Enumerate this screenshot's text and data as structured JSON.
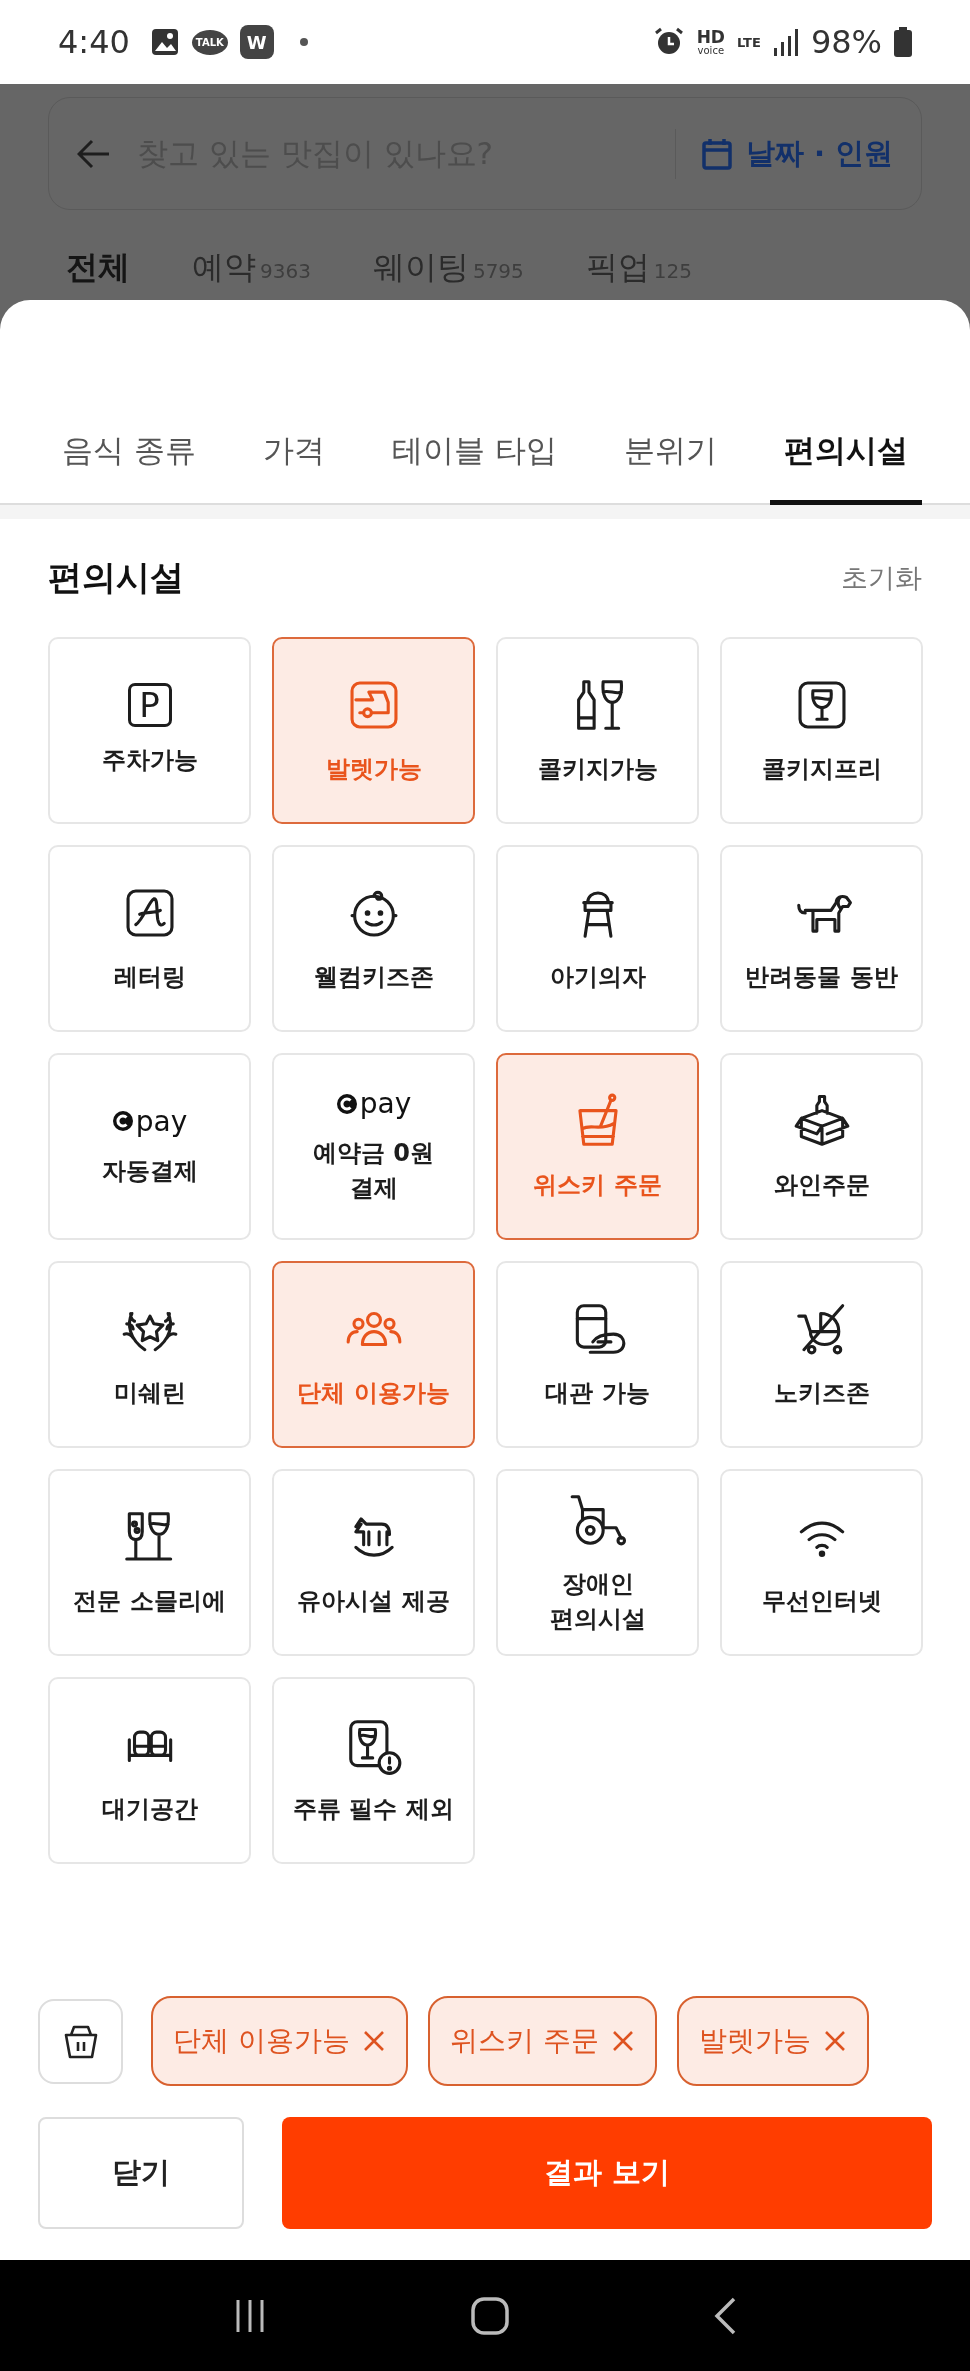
{
  "status_bar": {
    "time": "4:40",
    "talk": "TALK",
    "w": "W",
    "hd": "HD",
    "voice": "voice",
    "lte": "LTE",
    "battery": "98%"
  },
  "search": {
    "placeholder": "찾고 있는 맛집이 있나요?",
    "date_button": "날짜 · 인원"
  },
  "page_tabs": [
    {
      "label": "전체",
      "selected": true
    },
    {
      "label": "예약",
      "count": "9363",
      "selected": false
    },
    {
      "label": "웨이팅",
      "count": "5795",
      "selected": false
    },
    {
      "label": "픽업",
      "count": "125",
      "selected": false
    }
  ],
  "sheet_tabs": [
    {
      "label": "음식 종류",
      "selected": false
    },
    {
      "label": "가격",
      "selected": false
    },
    {
      "label": "테이블 타입",
      "selected": false
    },
    {
      "label": "분위기",
      "selected": false
    },
    {
      "label": "편의시설",
      "selected": true
    }
  ],
  "section": {
    "title": "편의시설",
    "reset": "초기화"
  },
  "facilities": [
    {
      "label": "주차가능",
      "symbol": "P",
      "selected": false
    },
    {
      "label": "발렛가능",
      "selected": true
    },
    {
      "label": "콜키지가능",
      "selected": false
    },
    {
      "label": "콜키지프리",
      "selected": false
    },
    {
      "label": "레터링",
      "selected": false
    },
    {
      "label": "웰컴키즈존",
      "selected": false
    },
    {
      "label": "아기의자",
      "selected": false
    },
    {
      "label": "반려동물 동반",
      "selected": false
    },
    {
      "label": "자동결제",
      "logo": "pay",
      "selected": false
    },
    {
      "label": "예약금 0원\n결제",
      "logo": "pay",
      "selected": false
    },
    {
      "label": "위스키 주문",
      "selected": true
    },
    {
      "label": "와인주문",
      "selected": false
    },
    {
      "label": "미쉐린",
      "selected": false
    },
    {
      "label": "단체 이용가능",
      "selected": true
    },
    {
      "label": "대관 가능",
      "selected": false
    },
    {
      "label": "노키즈존",
      "selected": false
    },
    {
      "label": "전문 소믈리에",
      "selected": false
    },
    {
      "label": "유아시설 제공",
      "selected": false
    },
    {
      "label": "장애인\n편의시설",
      "selected": false
    },
    {
      "label": "무선인터넷",
      "selected": false
    },
    {
      "label": "대기공간",
      "selected": false
    },
    {
      "label": "주류 필수 제외",
      "selected": false
    }
  ],
  "chips": [
    "단체 이용가능",
    "위스키 주문",
    "발렛가능"
  ],
  "buttons": {
    "close": "닫기",
    "results": "결과 보기"
  }
}
